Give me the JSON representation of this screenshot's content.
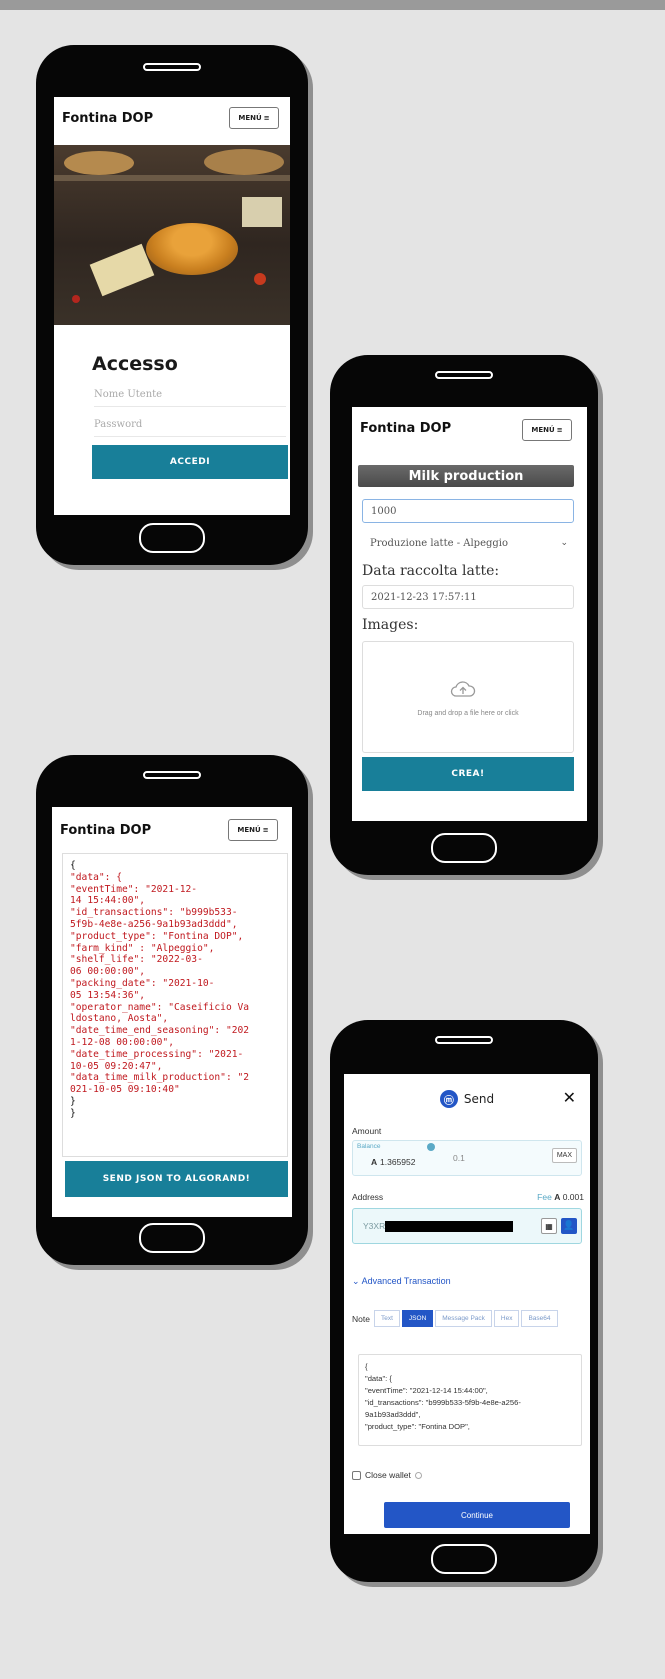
{
  "brand": "Fontina DOP",
  "menu_label": "MENÚ",
  "menu_glyph": "≡",
  "login": {
    "title": "Accesso",
    "username_placeholder": "Nome Utente",
    "password_placeholder": "Password",
    "submit_label": "ACCEDI"
  },
  "milk_form": {
    "header": "Milk production",
    "quantity_value": "1000",
    "type_value": "Produzione latte - Alpeggio",
    "date_label": "Data raccolta latte:",
    "date_value": "2021-12-23 17:57:11",
    "images_label": "Images:",
    "dropzone_text": "Drag and drop a file here or click",
    "submit_label": "CREA!"
  },
  "json_view": {
    "lines": [
      "{",
      "\"data\": {",
      "\"eventTime\": \"2021-12-",
      "14 15:44:00\",",
      "\"id_transactions\": \"b999b533-",
      "5f9b-4e8e-a256-9a1b93ad3ddd\",",
      "\"product_type\": \"Fontina DOP\",",
      "\"farm_kind\" : \"Alpeggio\",",
      "\"shelf_life\": \"2022-03-",
      "06 00:00:00\",",
      "\"packing_date\": \"2021-10-",
      "05 13:54:36\",",
      "\"operator_name\": \"Caseificio Va",
      "ldostano, Aosta\",",
      "\"date_time_end_seasoning\": \"202",
      "1-12-08 00:00:00\",",
      "\"date_time_processing\": \"2021-",
      "10-05 09:20:47\",",
      "\"data_time_milk_production\": \"2",
      "021-10-05 09:10:40\"",
      "}",
      "}"
    ],
    "send_label": "SEND JSON TO ALGORAND!"
  },
  "wallet": {
    "title": "Send",
    "close": "✕",
    "amount_label": "Amount",
    "balance_label": "Balance",
    "balance_value": "1.365952",
    "algo_symbol": "A",
    "amount_value": "0.1",
    "max_label": "MAX",
    "address_label": "Address",
    "fee_label": "Fee",
    "fee_value": "0.001",
    "address_prefix": "Y3XR",
    "advanced_label": "Advanced Transaction",
    "note_label": "Note",
    "tabs": [
      "Text",
      "JSON",
      "Message Pack",
      "Hex",
      "Base64"
    ],
    "active_tab": "JSON",
    "note_lines": [
      "{",
      "\"data\": {",
      "\"eventTime\": \"2021-12-14 15:44:00\",",
      "\"id_transactions\": \"b999b533-5f9b-4e8e-a256-",
      "9a1b93ad3ddd\",",
      "\"product_type\": \"Fontina DOP\","
    ],
    "close_wallet_label": "Close wallet",
    "continue_label": "Continue"
  },
  "colors": {
    "teal": "#187f99",
    "algo_blue": "#2356c6",
    "json_red": "#c0191f"
  }
}
